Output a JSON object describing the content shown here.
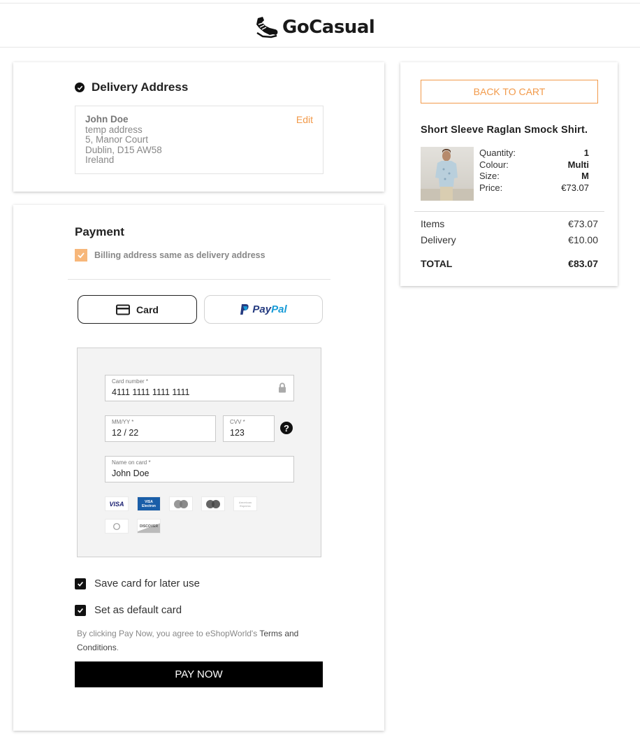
{
  "brand": {
    "name": "GoCasual",
    "logo_icon": "sneaker-icon"
  },
  "delivery": {
    "title": "Delivery Address",
    "name": "John Doe",
    "lines": [
      "temp address",
      "5, Manor Court",
      "Dublin, D15 AW58",
      "Ireland"
    ],
    "edit_label": "Edit"
  },
  "payment": {
    "title": "Payment",
    "billing_same_label": "Billing address same as delivery address",
    "billing_same_checked": true,
    "methods": {
      "card_label": "Card",
      "paypal_pay": "Pay",
      "paypal_pal": "Pal"
    },
    "card_form": {
      "number_label": "Card number *",
      "number_value": "4111 1111 1111 1111",
      "expiry_label": "MM/YY *",
      "expiry_value": "12 / 22",
      "cvv_label": "CVV *",
      "cvv_value": "123",
      "name_label": "Name on card *",
      "name_value": "John Doe",
      "brands": [
        "VISA",
        "VISA Electron",
        "Maestro",
        "Mastercard",
        "American Express",
        "Diners Club",
        "DISCOVER"
      ]
    },
    "save_card_label": "Save card for later use",
    "save_card_checked": true,
    "default_card_label": "Set as default card",
    "default_card_checked": true,
    "terms_prefix": "By clicking Pay Now, you agree to eShopWorld's",
    "terms_link": "Terms and Conditions",
    "terms_suffix": ".",
    "pay_now_label": "PAY NOW"
  },
  "summary": {
    "back_label": "BACK TO CART",
    "product_name": "Short Sleeve Raglan Smock Shirt.",
    "attributes": [
      {
        "label": "Quantity:",
        "value": "1"
      },
      {
        "label": "Colour:",
        "value": "Multi"
      },
      {
        "label": "Size:",
        "value": "M"
      },
      {
        "label": "Price:",
        "value": "€73.07"
      }
    ],
    "items_label": "Items",
    "items_value": "€73.07",
    "delivery_label": "Delivery",
    "delivery_value": "€10.00",
    "total_label": "TOTAL",
    "total_value": "€83.07"
  },
  "colors": {
    "accent": "#f29a4a",
    "checkbox_orange": "#f7b77a",
    "dark": "#111111"
  }
}
